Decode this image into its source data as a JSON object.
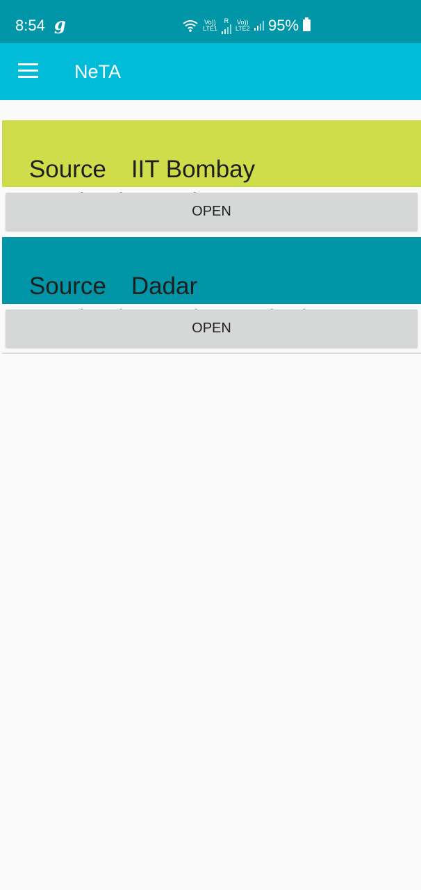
{
  "status_bar": {
    "time": "8:54",
    "notification_glyph": "g",
    "net1_top": "Vo))",
    "net1_bottom": "LTE1",
    "roaming": "R",
    "net2_top": "Vo))",
    "net2_bottom": "LTE2",
    "battery_percent": "95%",
    "icons": [
      "wifi-icon",
      "signal-icon",
      "battery-icon"
    ]
  },
  "app_bar": {
    "title": "NeTA",
    "menu_icon": "hamburger-menu-icon"
  },
  "routes": [
    {
      "source_label": "Source",
      "source": "IIT Bombay",
      "destination_label": "Destination",
      "destination": "Airport",
      "button_label": "OPEN",
      "color": "#cfdd4a"
    },
    {
      "source_label": "Source",
      "source": "Dadar",
      "destination_label": "Destination",
      "destination": "Hiranandani",
      "button_label": "OPEN",
      "color": "#0096a7"
    }
  ],
  "colors": {
    "status_bar": "#0096a7",
    "app_bar": "#00bcd9",
    "background": "#fafafa",
    "button": "#d6d7d7"
  }
}
